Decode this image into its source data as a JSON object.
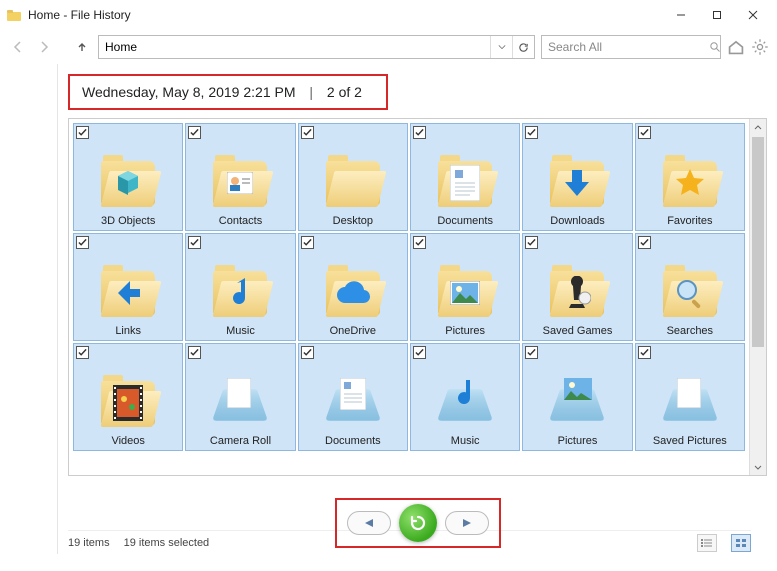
{
  "window": {
    "title": "Home - File History"
  },
  "toolbar": {
    "address": "Home",
    "search_placeholder": "Search All"
  },
  "date_bar": {
    "timestamp": "Wednesday, May 8, 2019 2:21 PM",
    "position": "2 of 2"
  },
  "status": {
    "count": "19 items",
    "selected": "19 items selected"
  },
  "items": [
    {
      "label": "3D Objects",
      "icon": "cube"
    },
    {
      "label": "Contacts",
      "icon": "contact"
    },
    {
      "label": "Desktop",
      "icon": "folder"
    },
    {
      "label": "Documents",
      "icon": "doc"
    },
    {
      "label": "Downloads",
      "icon": "download"
    },
    {
      "label": "Favorites",
      "icon": "star"
    },
    {
      "label": "Links",
      "icon": "arrow-up"
    },
    {
      "label": "Music",
      "icon": "note"
    },
    {
      "label": "OneDrive",
      "icon": "cloud"
    },
    {
      "label": "Pictures",
      "icon": "picture"
    },
    {
      "label": "Saved Games",
      "icon": "chess"
    },
    {
      "label": "Searches",
      "icon": "magnify"
    },
    {
      "label": "Videos",
      "icon": "film"
    },
    {
      "label": "Camera Roll",
      "icon": "doc-library"
    },
    {
      "label": "Documents",
      "icon": "doc-library2"
    },
    {
      "label": "Music",
      "icon": "note-library"
    },
    {
      "label": "Pictures",
      "icon": "picture-library"
    },
    {
      "label": "Saved Pictures",
      "icon": "doc-library"
    }
  ]
}
